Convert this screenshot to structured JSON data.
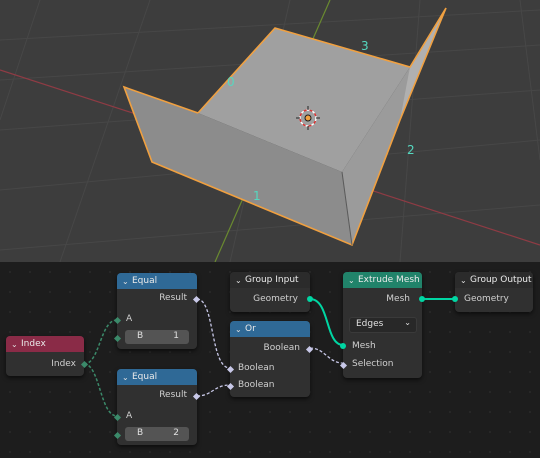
{
  "viewport": {
    "edge_labels": [
      "0",
      "1",
      "2",
      "3"
    ]
  },
  "nodes": {
    "index": {
      "title": "Index",
      "output": "Index"
    },
    "equal_top": {
      "title": "Equal",
      "output": "Result",
      "input_a": "A",
      "b_label": "B",
      "b_value": "1"
    },
    "equal_bottom": {
      "title": "Equal",
      "output": "Result",
      "input_a": "A",
      "b_label": "B",
      "b_value": "2"
    },
    "group_input": {
      "title": "Group Input",
      "output": "Geometry"
    },
    "or": {
      "title": "Or",
      "output": "Boolean",
      "input_1": "Boolean",
      "input_2": "Boolean"
    },
    "extrude_mesh": {
      "title": "Extrude Mesh",
      "output": "Mesh",
      "mode": "Edges",
      "input_mesh": "Mesh",
      "input_selection": "Selection"
    },
    "group_output": {
      "title": "Group Output",
      "input": "Geometry"
    }
  },
  "colors": {
    "selection_outline": "#f0a040",
    "edge_label": "#55d8c0",
    "geometry_wire": "#00d6a3",
    "header_blue": "#2f6996",
    "header_red": "#8a2b47",
    "header_green": "#21836a"
  }
}
